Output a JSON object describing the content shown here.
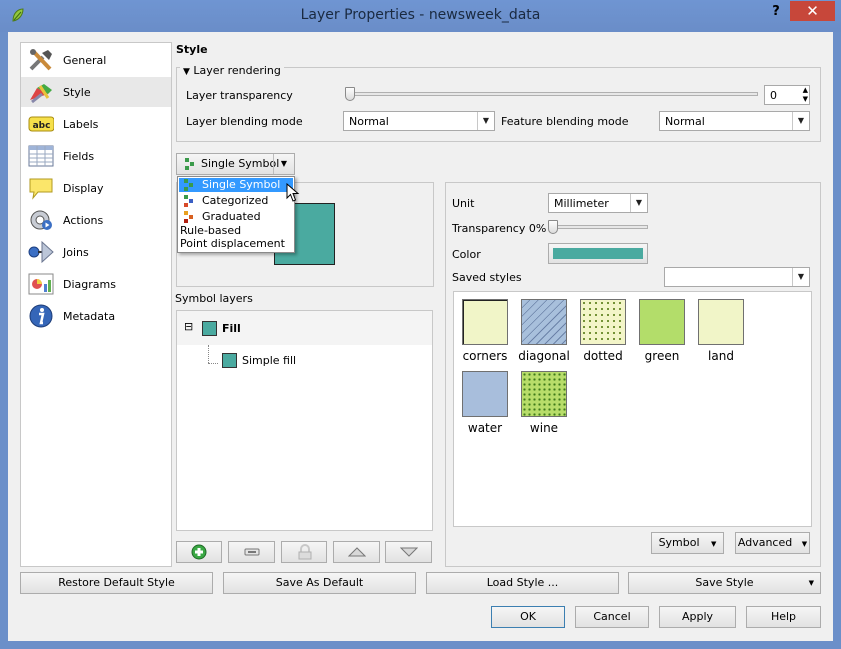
{
  "window": {
    "title": "Layer Properties - newsweek_data",
    "help_label": "?",
    "close_label": "✕"
  },
  "sidebar": {
    "items": [
      {
        "label": "General",
        "icon": "tools-icon"
      },
      {
        "label": "Style",
        "icon": "paint-brush-icon"
      },
      {
        "label": "Labels",
        "icon": "abc-label-icon"
      },
      {
        "label": "Fields",
        "icon": "table-icon"
      },
      {
        "label": "Display",
        "icon": "speech-bubble-icon"
      },
      {
        "label": "Actions",
        "icon": "gear-play-icon"
      },
      {
        "label": "Joins",
        "icon": "join-icon"
      },
      {
        "label": "Diagrams",
        "icon": "chart-icon"
      },
      {
        "label": "Metadata",
        "icon": "info-icon"
      }
    ],
    "abc_text": "abc"
  },
  "style": {
    "section_title": "Style",
    "layer_rendering": {
      "group_title": "Layer rendering",
      "transparency_label": "Layer transparency",
      "transparency_value": "0",
      "transparency_level": 0,
      "blending_label": "Layer blending mode",
      "blending_value": "Normal",
      "feature_blending_label": "Feature blending mode",
      "feature_blending_value": "Normal"
    },
    "renderer_button": "Single Symbol",
    "renderer_menu": [
      "Single Symbol",
      "Categorized",
      "Graduated",
      "Rule-based",
      "Point displacement"
    ],
    "symbol_layers_label": "Symbol layers",
    "tree": {
      "root": "Fill",
      "child": "Simple fill",
      "expander": "⊟"
    },
    "fill_color": "#4aaaa0",
    "props": {
      "unit_label": "Unit",
      "unit_value": "Millimeter",
      "transparency_label": "Transparency 0%",
      "transparency_level": 0,
      "color_label": "Color",
      "color_value": "#4aaaa0",
      "saved_styles_label": "Saved styles",
      "saved_styles_value": ""
    },
    "swatches": [
      {
        "name": "corners",
        "color": "#f1f5c8"
      },
      {
        "name": "diagonal",
        "color": "#a8c0dc"
      },
      {
        "name": "dotted",
        "color": "#f3f5c8"
      },
      {
        "name": "green",
        "color": "#b3dd6a"
      },
      {
        "name": "land",
        "color": "#f1f5c8"
      },
      {
        "name": "water",
        "color": "#a8bedc"
      },
      {
        "name": "wine",
        "color": "#b8dd6a"
      }
    ],
    "symbol_button": "Symbol",
    "advanced_button": "Advanced"
  },
  "bottom": {
    "restore_default": "Restore Default Style",
    "save_as_default": "Save As Default",
    "load_style": "Load Style ...",
    "save_style": "Save Style",
    "ok": "OK",
    "cancel": "Cancel",
    "apply": "Apply",
    "help": "Help"
  }
}
